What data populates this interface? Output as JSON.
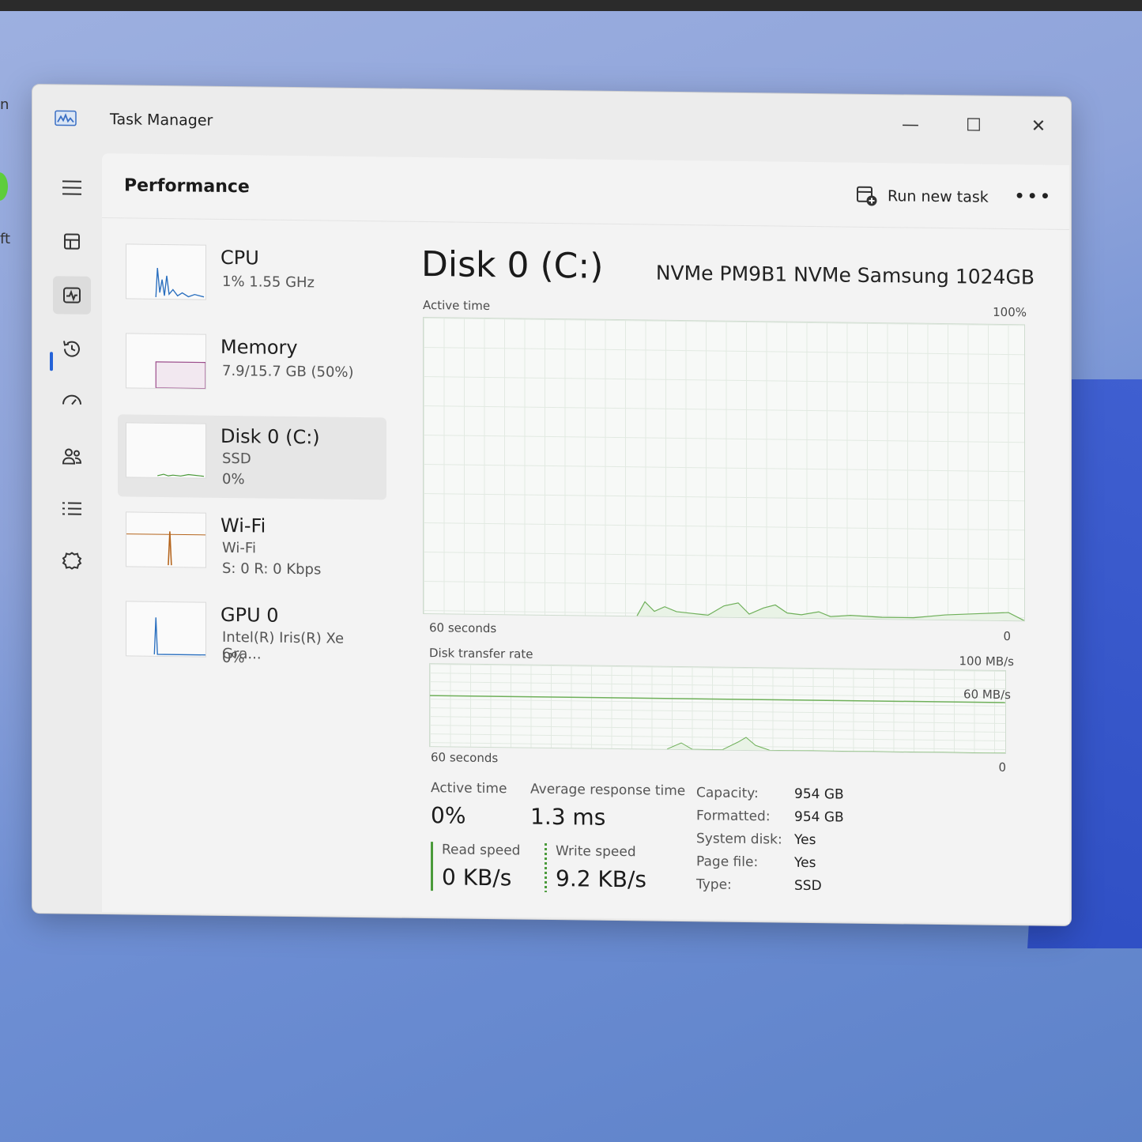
{
  "desktop": {
    "edge_text_1": "n",
    "edge_text_2": "ft"
  },
  "window": {
    "title": "Task Manager",
    "controls": {
      "minimize": "—",
      "maximize": "☐",
      "close": "✕"
    }
  },
  "nav": {
    "icons": [
      "hamburger-menu-icon",
      "processes-icon",
      "performance-icon",
      "app-history-icon",
      "startup-apps-icon",
      "users-icon",
      "details-icon",
      "services-icon",
      "settings-icon"
    ]
  },
  "header": {
    "title": "Performance",
    "run_task_label": "Run new task",
    "more_label": "•••"
  },
  "devices": [
    {
      "name": "CPU",
      "sub1": "1%  1.55 GHz",
      "sub2": ""
    },
    {
      "name": "Memory",
      "sub1": "7.9/15.7 GB (50%)",
      "sub2": ""
    },
    {
      "name": "Disk 0 (C:)",
      "sub1": "SSD",
      "sub2": "0%"
    },
    {
      "name": "Wi-Fi",
      "sub1": "Wi-Fi",
      "sub2": "S: 0 R: 0 Kbps"
    },
    {
      "name": "GPU 0",
      "sub1": "Intel(R) Iris(R) Xe Gra...",
      "sub2": "0%"
    }
  ],
  "colors": {
    "disk_accent": "#4a9a3a",
    "cpu_line": "#2a6fbf",
    "memory_line": "#9a4a8a",
    "wifi_line": "#b5651d",
    "gpu_line": "#2a6fbf"
  },
  "detail": {
    "title": "Disk 0 (C:)",
    "model": "NVMe PM9B1 NVMe Samsung 1024GB",
    "graph1": {
      "label": "Active time",
      "max": "100%",
      "time": "60 seconds",
      "min": "0"
    },
    "graph2": {
      "label": "Disk transfer rate",
      "max": "100 MB/s",
      "mid": "60 MB/s",
      "time": "60 seconds",
      "min": "0"
    },
    "stats": {
      "active_time_label": "Active time",
      "active_time_value": "0%",
      "avg_response_label": "Average response time",
      "avg_response_value": "1.3 ms",
      "read_speed_label": "Read speed",
      "read_speed_value": "0 KB/s",
      "write_speed_label": "Write speed",
      "write_speed_value": "9.2 KB/s"
    },
    "properties": [
      {
        "key": "Capacity:",
        "value": "954 GB"
      },
      {
        "key": "Formatted:",
        "value": "954 GB"
      },
      {
        "key": "System disk:",
        "value": "Yes"
      },
      {
        "key": "Page file:",
        "value": "Yes"
      },
      {
        "key": "Type:",
        "value": "SSD"
      }
    ]
  }
}
